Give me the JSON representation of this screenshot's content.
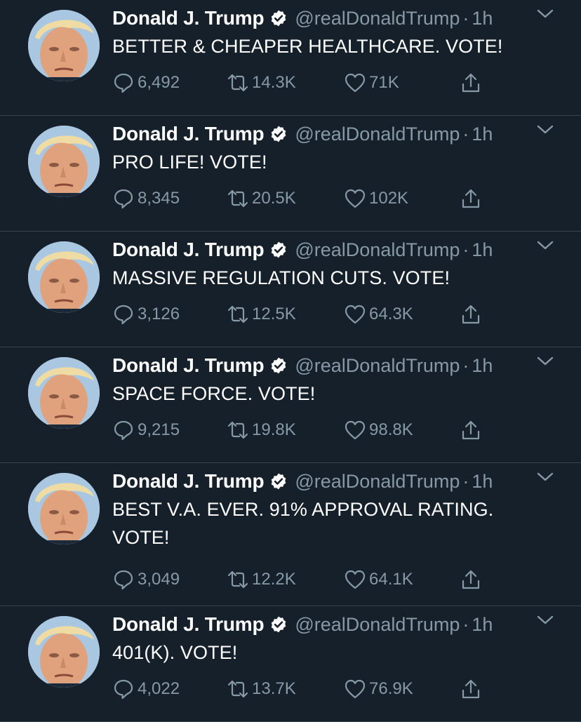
{
  "colors": {
    "background": "#15202b",
    "divider": "#38444d",
    "text_primary": "#ffffff",
    "text_secondary": "#8899a6",
    "verified_badge": "#ffffff"
  },
  "icons": {
    "reply": "reply-icon",
    "retweet": "retweet-icon",
    "like": "heart-icon",
    "share": "share-icon",
    "verified": "verified-badge-icon",
    "more": "chevron-down-icon"
  },
  "tweets": [
    {
      "author_name": "Donald J. Trump",
      "handle": "@realDonaldTrump",
      "separator": "·",
      "time": "1h",
      "text": "BETTER & CHEAPER HEALTHCARE. VOTE!",
      "replies": "6,492",
      "retweets": "14.3K",
      "likes": "71K"
    },
    {
      "author_name": "Donald J. Trump",
      "handle": "@realDonaldTrump",
      "separator": "·",
      "time": "1h",
      "text": "PRO LIFE! VOTE!",
      "replies": "8,345",
      "retweets": "20.5K",
      "likes": "102K"
    },
    {
      "author_name": "Donald J. Trump",
      "handle": "@realDonaldTrump",
      "separator": "·",
      "time": "1h",
      "text": "MASSIVE REGULATION CUTS. VOTE!",
      "replies": "3,126",
      "retweets": "12.5K",
      "likes": "64.3K"
    },
    {
      "author_name": "Donald J. Trump",
      "handle": "@realDonaldTrump",
      "separator": "·",
      "time": "1h",
      "text": "SPACE FORCE. VOTE!",
      "replies": "9,215",
      "retweets": "19.8K",
      "likes": "98.8K"
    },
    {
      "author_name": "Donald J. Trump",
      "handle": "@realDonaldTrump",
      "separator": "·",
      "time": "1h",
      "text": "BEST V.A. EVER. 91% APPROVAL RATING. VOTE!",
      "replies": "3,049",
      "retweets": "12.2K",
      "likes": "64.1K"
    },
    {
      "author_name": "Donald J. Trump",
      "handle": "@realDonaldTrump",
      "separator": "·",
      "time": "1h",
      "text": "401(K). VOTE!",
      "replies": "4,022",
      "retweets": "13.7K",
      "likes": "76.9K"
    }
  ]
}
